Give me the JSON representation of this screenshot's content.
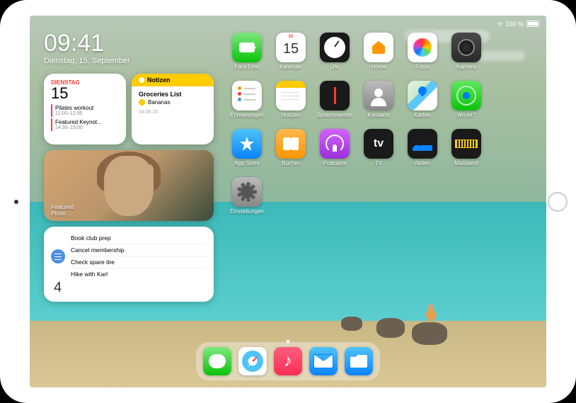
{
  "status": {
    "battery": "100 %"
  },
  "clock": {
    "time": "09:41",
    "date": "Dienstag, 15. September"
  },
  "widgets": {
    "calendar": {
      "day": "DIENSTAG",
      "num": "15",
      "events": [
        {
          "title": "Pilates workout",
          "time": "11:00–12:00"
        },
        {
          "title": "Featured Keynot...",
          "time": "14:30–15:00"
        }
      ]
    },
    "notes": {
      "header": "Notizen",
      "title": "Groceries List",
      "item": "Bananas",
      "date": "24.06.20"
    },
    "photo": {
      "label": "Featured\nPhoto"
    },
    "reminders": {
      "items": [
        "Book club prep",
        "Cancel membership",
        "Check spare tire",
        "Hike with Karl"
      ],
      "count": "4"
    }
  },
  "apps": [
    {
      "name": "FaceTime",
      "cls": "facetime"
    },
    {
      "name": "Kalender",
      "cls": "cal",
      "day": "DI",
      "num": "15"
    },
    {
      "name": "Uhr",
      "cls": "clock-ic"
    },
    {
      "name": "Home",
      "cls": "home-ic"
    },
    {
      "name": "Fotos",
      "cls": "photos"
    },
    {
      "name": "Kamera",
      "cls": "camera-ic"
    },
    {
      "name": "Erinnerungen",
      "cls": "rem"
    },
    {
      "name": "Notizen",
      "cls": "notes"
    },
    {
      "name": "Sprachmemos",
      "cls": "voice"
    },
    {
      "name": "Kontakte",
      "cls": "contacts"
    },
    {
      "name": "Karten",
      "cls": "maps"
    },
    {
      "name": "Wo ist?",
      "cls": "findmy"
    },
    {
      "name": "App Store",
      "cls": "store"
    },
    {
      "name": "Bücher",
      "cls": "books"
    },
    {
      "name": "Podcasts",
      "cls": "podcasts"
    },
    {
      "name": "TV",
      "cls": "tv"
    },
    {
      "name": "Aktien",
      "cls": "stocks"
    },
    {
      "name": "Maßband",
      "cls": "measure"
    },
    {
      "name": "Einstellungen",
      "cls": "settings"
    }
  ],
  "dock": [
    {
      "name": "Nachrichten",
      "cls": "messages"
    },
    {
      "name": "Safari",
      "cls": "safari"
    },
    {
      "name": "Musik",
      "cls": "music"
    },
    {
      "name": "Mail",
      "cls": "mail"
    },
    {
      "name": "Dateien",
      "cls": "files"
    }
  ]
}
